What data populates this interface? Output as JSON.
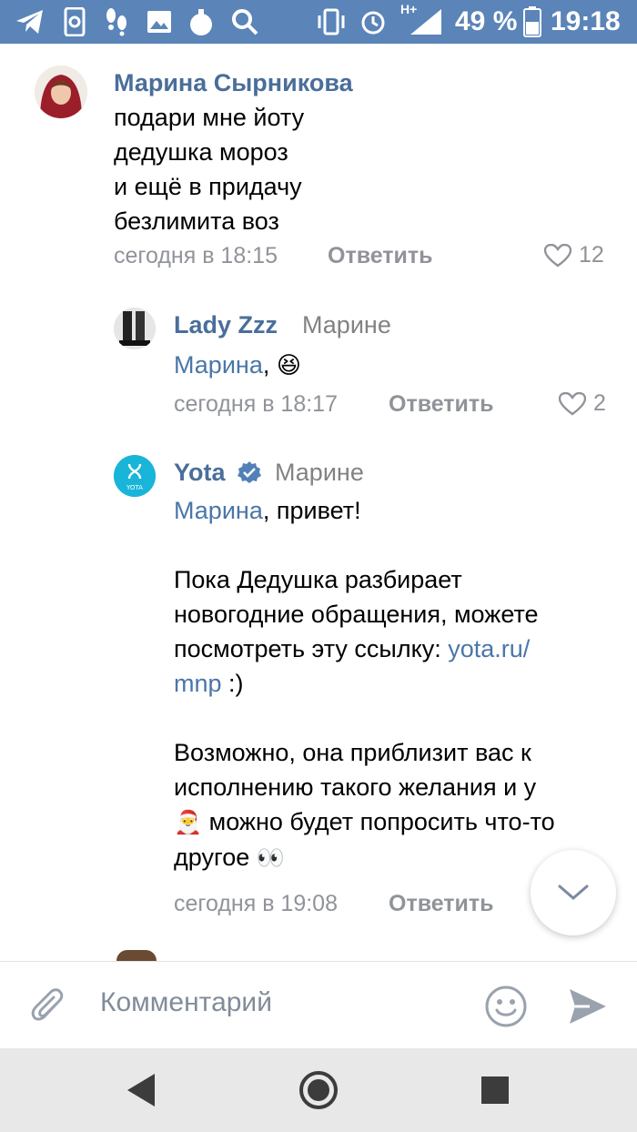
{
  "status_bar": {
    "battery_percent": "49 %",
    "time": "19:18",
    "network_label": "H+",
    "icons": [
      "telegram-icon",
      "app-icon",
      "footsteps-icon",
      "gallery-icon",
      "bomb-icon",
      "search-icon",
      "vibrate-icon",
      "alarm-icon",
      "signal-icon",
      "battery-icon"
    ]
  },
  "comments": [
    {
      "author": "Марина Сырникова",
      "lines": [
        "подари мне йоту",
        "дедушка мороз",
        "и ещё в придачу",
        "безлимита воз"
      ],
      "time": "сегодня в 18:15",
      "reply_label": "Ответить",
      "likes": "12"
    },
    {
      "author": "Lady Zzz",
      "reply_to": "Марине",
      "mention": "Марина",
      "text_after_mention": ",",
      "emoji": "😆",
      "time": "сегодня в 18:17",
      "reply_label": "Ответить",
      "likes": "2"
    },
    {
      "author": "Yota",
      "verified": true,
      "reply_to": "Марине",
      "mention": "Марина",
      "greeting": ", привет!",
      "paragraph1": [
        "Пока Дедушка разбирает",
        "новогодние обращения, можете",
        "посмотреть эту ссылку: "
      ],
      "link_part1": "yota.ru/",
      "link_part2": "mnp",
      "link_after": " :)",
      "paragraph2": [
        "Возможно, она приблизит вас к",
        "исполнению такого желания и у"
      ],
      "santa_emoji": "🎅",
      "line_after_santa": " можно будет попросить что-то",
      "last_line": "другое ",
      "eyes_emoji": "👀",
      "time": "сегодня в 19:08",
      "reply_label": "Ответить"
    }
  ],
  "composer": {
    "placeholder": "Комментарий"
  },
  "colors": {
    "status_bar": "#5b84b8",
    "author": "#4a6e9a",
    "link": "#4a76a8",
    "meta": "#909399"
  }
}
